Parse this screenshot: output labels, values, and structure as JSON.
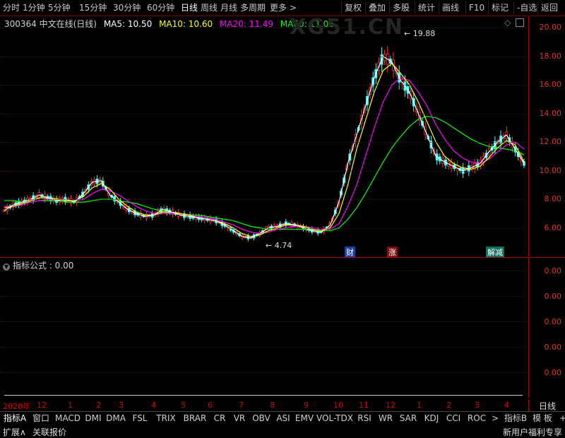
{
  "toolbar": {
    "left_items": [
      "分时",
      "1分钟",
      "5分钟",
      "15分钟",
      "30分钟",
      "60分钟",
      "日线",
      "周线",
      "月线",
      "多周期",
      "更多 >"
    ],
    "active": "日线",
    "right_items": [
      "复权",
      "叠加",
      "多股",
      "统计",
      "画线",
      "F10",
      "标记",
      "-自选",
      "返回"
    ]
  },
  "chart_header": {
    "title": "300364 中文在线(日线)",
    "ma5": "MA5: 10.50",
    "ma10": "MA10: 10.60",
    "ma20": "MA20: 11.49",
    "ma60": "MA60: 11.06",
    "watermark": "XG51.CN"
  },
  "colors": {
    "ma5": "#ffffff",
    "ma10": "#ffff00",
    "ma20": "#ff00ff",
    "ma60": "#00ff00",
    "up": "#ff3030",
    "down": "#40ffff",
    "axis": "#ff3030"
  },
  "price_axis": [
    "20.00",
    "18.00",
    "16.00",
    "14.00",
    "12.00",
    "10.00",
    "8.00",
    "6.00"
  ],
  "annotations": {
    "high": "19.88",
    "low": "4.74"
  },
  "events": [
    "财",
    "涨",
    "解减"
  ],
  "indicator": {
    "title": "指标公式 : 0.00",
    "axis": [
      "0.00",
      "0.00",
      "0.00",
      "0.00",
      "0.00"
    ]
  },
  "time_axis": [
    "2020年",
    "12",
    "1",
    "2",
    "3",
    "4",
    "5",
    "6",
    "7",
    "8",
    "9",
    "10",
    "11",
    "12",
    "1",
    "2",
    "3",
    "4"
  ],
  "time_axis_right": "日线",
  "tabs": [
    "指标A",
    "窗口",
    "MACD",
    "DMI",
    "DMA",
    "FSL",
    "TRIX",
    "BRAR",
    "CR",
    "VR",
    "OBV",
    "ASI",
    "EMV",
    "VOL-TDX",
    "RSI",
    "WR",
    "SAR",
    "KDJ",
    "CCI",
    "ROC",
    ">",
    "指标B",
    "模 板",
    "+",
    "-"
  ],
  "bottom": {
    "left1": "扩展∧",
    "left2": "关联报价",
    "right": "新用户福利专享"
  },
  "chart_data": {
    "type": "line",
    "series": [
      {
        "name": "MA5",
        "values": [
          7.2,
          7.6,
          7.8,
          8.0,
          8.3,
          8.1,
          7.9,
          8.0,
          7.8,
          8.4,
          9.2,
          9.3,
          8.3,
          7.8,
          7.3,
          7.0,
          6.8,
          6.9,
          7.3,
          7.1,
          6.9,
          6.8,
          6.7,
          6.6,
          6.5,
          6.2,
          5.8,
          5.4,
          5.3,
          5.6,
          6.0,
          6.1,
          6.3,
          6.2,
          6.0,
          5.8,
          5.7,
          6.2,
          7.8,
          10.5,
          12.5,
          14.5,
          16.5,
          18.0,
          17.6,
          16.3,
          15.5,
          14.0,
          12.5,
          11.0,
          10.6,
          10.3,
          10.0,
          10.2,
          10.5,
          11.3,
          12.0,
          12.5,
          11.5,
          10.5
        ]
      },
      {
        "name": "MA10",
        "values": [
          7.4,
          7.5,
          7.7,
          7.9,
          8.1,
          8.1,
          8.0,
          7.9,
          7.9,
          8.2,
          8.8,
          9.1,
          8.7,
          8.0,
          7.5,
          7.1,
          6.9,
          6.9,
          7.1,
          7.1,
          7.0,
          6.9,
          6.7,
          6.6,
          6.5,
          6.3,
          6.0,
          5.6,
          5.4,
          5.5,
          5.8,
          6.0,
          6.2,
          6.2,
          6.1,
          5.9,
          5.8,
          6.0,
          7.0,
          9.0,
          11.5,
          13.5,
          15.5,
          17.0,
          17.5,
          16.8,
          16.0,
          14.8,
          13.4,
          12.0,
          11.0,
          10.5,
          10.2,
          10.1,
          10.3,
          10.9,
          11.6,
          12.1,
          11.8,
          10.6
        ]
      },
      {
        "name": "MA20",
        "values": [
          7.5,
          7.5,
          7.6,
          7.8,
          7.9,
          8.0,
          8.0,
          7.9,
          7.9,
          8.0,
          8.4,
          8.7,
          8.6,
          8.3,
          7.9,
          7.5,
          7.2,
          7.0,
          7.0,
          7.0,
          7.0,
          6.9,
          6.8,
          6.7,
          6.6,
          6.4,
          6.2,
          5.9,
          5.7,
          5.6,
          5.7,
          5.9,
          6.0,
          6.1,
          6.1,
          6.0,
          5.9,
          5.9,
          6.3,
          7.5,
          9.0,
          11.0,
          13.0,
          14.8,
          16.0,
          16.5,
          16.3,
          15.5,
          14.5,
          13.2,
          12.2,
          11.4,
          10.9,
          10.6,
          10.5,
          10.8,
          11.3,
          11.8,
          12.0,
          11.5
        ]
      },
      {
        "name": "MA60",
        "values": [
          7.9,
          7.9,
          7.8,
          7.8,
          7.9,
          7.9,
          7.9,
          7.8,
          7.8,
          7.8,
          7.9,
          8.0,
          8.0,
          7.9,
          7.8,
          7.7,
          7.5,
          7.3,
          7.2,
          7.1,
          7.0,
          6.9,
          6.9,
          6.8,
          6.7,
          6.6,
          6.5,
          6.3,
          6.1,
          6.0,
          5.9,
          5.9,
          5.9,
          5.9,
          5.9,
          5.8,
          5.8,
          5.8,
          6.0,
          6.6,
          7.4,
          8.4,
          9.5,
          10.6,
          11.6,
          12.4,
          13.1,
          13.6,
          13.8,
          13.7,
          13.4,
          13.0,
          12.6,
          12.2,
          11.9,
          11.7,
          11.6,
          11.5,
          11.4,
          11.1
        ]
      }
    ],
    "ylim": [
      4.0,
      20.8
    ]
  }
}
